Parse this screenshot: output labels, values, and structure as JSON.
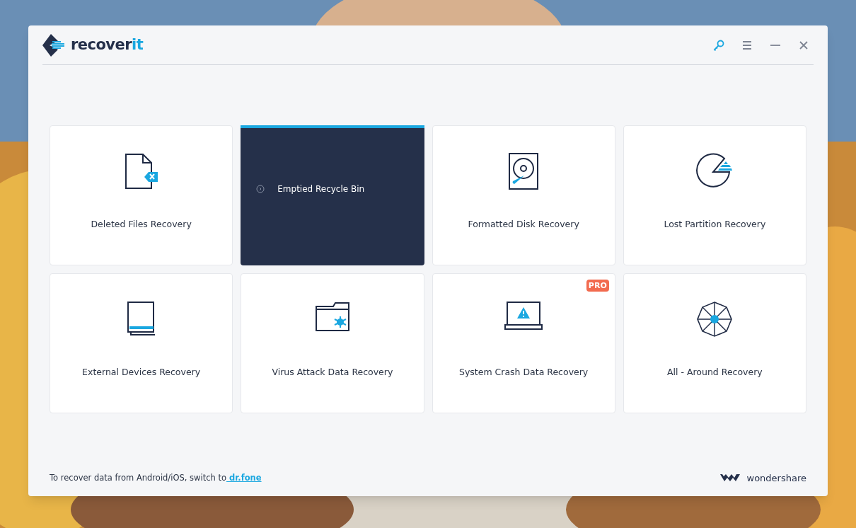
{
  "logo": {
    "text": "recover",
    "accent": "it"
  },
  "cards": [
    {
      "kind": "deleted-file",
      "label": "Deleted Files Recovery",
      "selected": false
    },
    {
      "label": "Emptied Recycle Bin",
      "selected": true
    },
    {
      "kind": "disk",
      "label": "Formatted Disk Recovery",
      "selected": false
    },
    {
      "kind": "partition",
      "label": "Lost Partition Recovery",
      "selected": false
    },
    {
      "kind": "external",
      "label": "External Devices Recovery",
      "selected": false
    },
    {
      "kind": "virus",
      "label": "Virus Attack Data Recovery",
      "selected": false
    },
    {
      "kind": "crash",
      "label": "System Crash Data Recovery",
      "selected": false,
      "badge": "PRO"
    },
    {
      "kind": "all",
      "label": "All - Around Recovery",
      "selected": false
    }
  ],
  "footer": {
    "text": "To recover data from Android/iOS, switch to",
    "link": " dr.fone",
    "brand": "wondershare"
  }
}
